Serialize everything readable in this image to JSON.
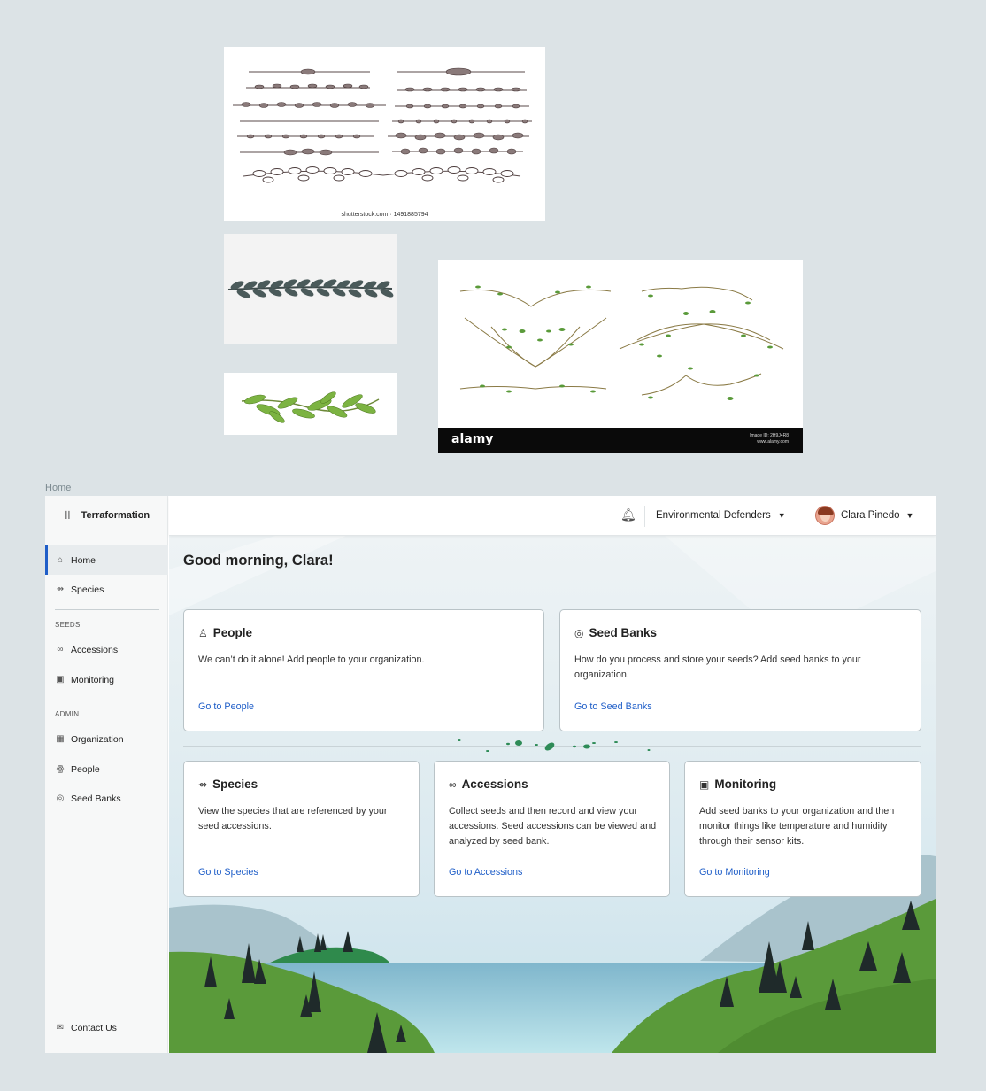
{
  "frame_label": "Home",
  "reference_images": {
    "shutterstock_caption": "shutterstock.com · 1491885794",
    "alamy_logo": "alamy",
    "alamy_image_id": "Image ID: 2H9J4R8",
    "alamy_url": "www.alamy.com"
  },
  "app": {
    "logo_text": "Terraformation",
    "topbar": {
      "organization": "Environmental Defenders",
      "user_name": "Clara Pinedo"
    },
    "sidebar": {
      "items": [
        {
          "label": "Home",
          "icon": "home-icon"
        },
        {
          "label": "Species",
          "icon": "species-icon"
        }
      ],
      "seeds_section": "SEEDS",
      "seeds_items": [
        {
          "label": "Accessions",
          "icon": "accessions-icon"
        },
        {
          "label": "Monitoring",
          "icon": "monitoring-icon"
        }
      ],
      "admin_section": "ADMIN",
      "admin_items": [
        {
          "label": "Organization",
          "icon": "organization-icon"
        },
        {
          "label": "People",
          "icon": "people-icon"
        },
        {
          "label": "Seed Banks",
          "icon": "seed-bank-icon"
        }
      ],
      "contact": "Contact Us"
    },
    "greeting": "Good morning, Clara!",
    "cards": {
      "people": {
        "title": "People",
        "desc": "We can’t do it alone! Add people to your organization.",
        "link": "Go to People"
      },
      "seed_banks": {
        "title": "Seed Banks",
        "desc": "How do you process and store your seeds? Add seed banks to your organization.",
        "link": "Go to Seed Banks"
      },
      "species": {
        "title": "Species",
        "desc": "View the species that are referenced by your seed accessions.",
        "link": "Go to Species"
      },
      "accessions": {
        "title": "Accessions",
        "desc": "Collect seeds and then record and view your accessions. Seed accessions can be viewed and analyzed by seed bank.",
        "link": "Go to Accessions"
      },
      "monitoring": {
        "title": "Monitoring",
        "desc": "Add seed banks to your organization and then monitor things like temperature and humidity through their sensor kits.",
        "link": "Go to Monitoring"
      }
    },
    "colors": {
      "accent": "#1f5ec8",
      "grass": "#5a9a3a",
      "water": "#8cc3d6"
    }
  }
}
